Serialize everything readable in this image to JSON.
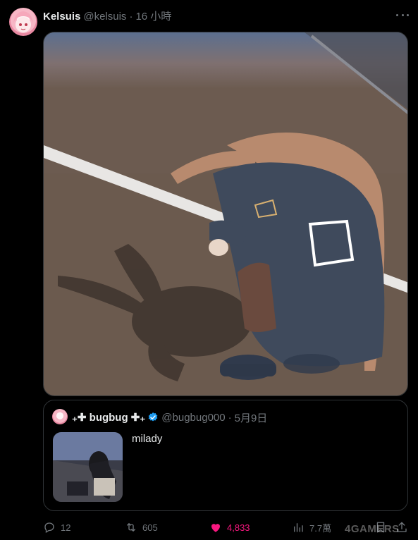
{
  "tweet": {
    "display_name": "Kelsuis",
    "handle": "@kelsuis",
    "separator": "·",
    "time": "16 小時",
    "avatar_icon": "avatar-pink-anime"
  },
  "quote": {
    "display_name": "₊✚ bugbug ✚₊",
    "handle": "@bugbug000",
    "separator": "·",
    "date": "5月9日",
    "text": "milady"
  },
  "actions": {
    "reply_count": "12",
    "retweet_count": "605",
    "like_count": "4,833",
    "views_count": "7.7萬"
  },
  "watermark": "4GAMERS",
  "colors": {
    "background": "#000000",
    "muted": "#71767b",
    "like": "#f91880",
    "verified": "#1d9bf0"
  }
}
